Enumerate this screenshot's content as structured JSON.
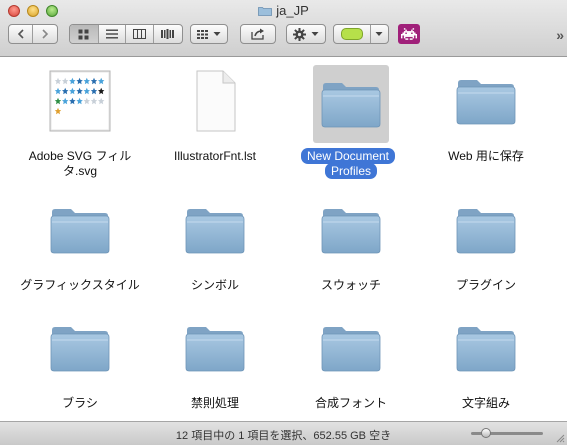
{
  "window": {
    "title": "ja_JP"
  },
  "toolbar": {
    "back_icon": "chevron-left-icon",
    "forward_icon": "chevron-right-icon",
    "view_modes": [
      "icon-view-icon",
      "list-view-icon",
      "column-view-icon",
      "coverflow-view-icon"
    ],
    "arrange_icon": "arrange-grid-icon",
    "share_icon": "share-icon",
    "action_icon": "gear-icon",
    "tag_color": "#b6e04a",
    "app_icon": "space-invader-icon",
    "app_color": "#a0207a",
    "overflow": "»"
  },
  "items": [
    {
      "name": "Adobe SVG フィルタ.svg",
      "kind": "svg-file",
      "selected": false
    },
    {
      "name": "IllustratorFnt.lst",
      "kind": "blank-file",
      "selected": false
    },
    {
      "name": "New Document Profiles",
      "kind": "folder",
      "selected": true
    },
    {
      "name": "Web 用に保存",
      "kind": "folder",
      "selected": false
    },
    {
      "name": "グラフィックスタイル",
      "kind": "folder",
      "selected": false
    },
    {
      "name": "シンボル",
      "kind": "folder",
      "selected": false
    },
    {
      "name": "スウォッチ",
      "kind": "folder",
      "selected": false
    },
    {
      "name": "プラグイン",
      "kind": "folder",
      "selected": false
    },
    {
      "name": "ブラシ",
      "kind": "folder",
      "selected": false
    },
    {
      "name": "禁則処理",
      "kind": "folder",
      "selected": false
    },
    {
      "name": "合成フォント",
      "kind": "folder",
      "selected": false
    },
    {
      "name": "文字組み",
      "kind": "folder",
      "selected": false
    }
  ],
  "status": {
    "text": "12 項目中の 1 項目を選択、652.55 GB 空き"
  },
  "colors": {
    "selection": "#3f76d6",
    "folder": "#8fb4d3"
  }
}
